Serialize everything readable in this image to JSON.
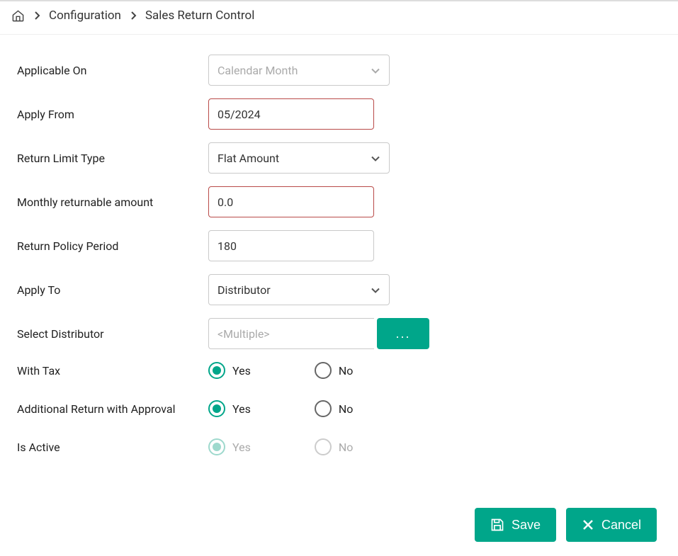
{
  "breadcrumb": {
    "home_icon": "home",
    "item1": "Configuration",
    "item2": "Sales Return Control"
  },
  "form": {
    "applicable_on": {
      "label": "Applicable On",
      "value": "Calendar Month"
    },
    "apply_from": {
      "label": "Apply From",
      "value": "05/2024"
    },
    "return_limit_type": {
      "label": "Return Limit Type",
      "value": "Flat Amount"
    },
    "monthly_returnable": {
      "label": "Monthly returnable amount",
      "value": "0.0"
    },
    "return_policy_period": {
      "label": "Return Policy Period",
      "value": "180"
    },
    "apply_to": {
      "label": "Apply To",
      "value": "Distributor"
    },
    "select_distributor": {
      "label": "Select Distributor",
      "placeholder": "<Multiple>",
      "button": "..."
    },
    "with_tax": {
      "label": "With Tax",
      "yes": "Yes",
      "no": "No",
      "selected": "yes"
    },
    "additional_return": {
      "label": "Additional Return with Approval",
      "yes": "Yes",
      "no": "No",
      "selected": "yes"
    },
    "is_active": {
      "label": "Is Active",
      "yes": "Yes",
      "no": "No",
      "selected": "yes",
      "disabled": true
    }
  },
  "footer": {
    "save": "Save",
    "cancel": "Cancel"
  }
}
